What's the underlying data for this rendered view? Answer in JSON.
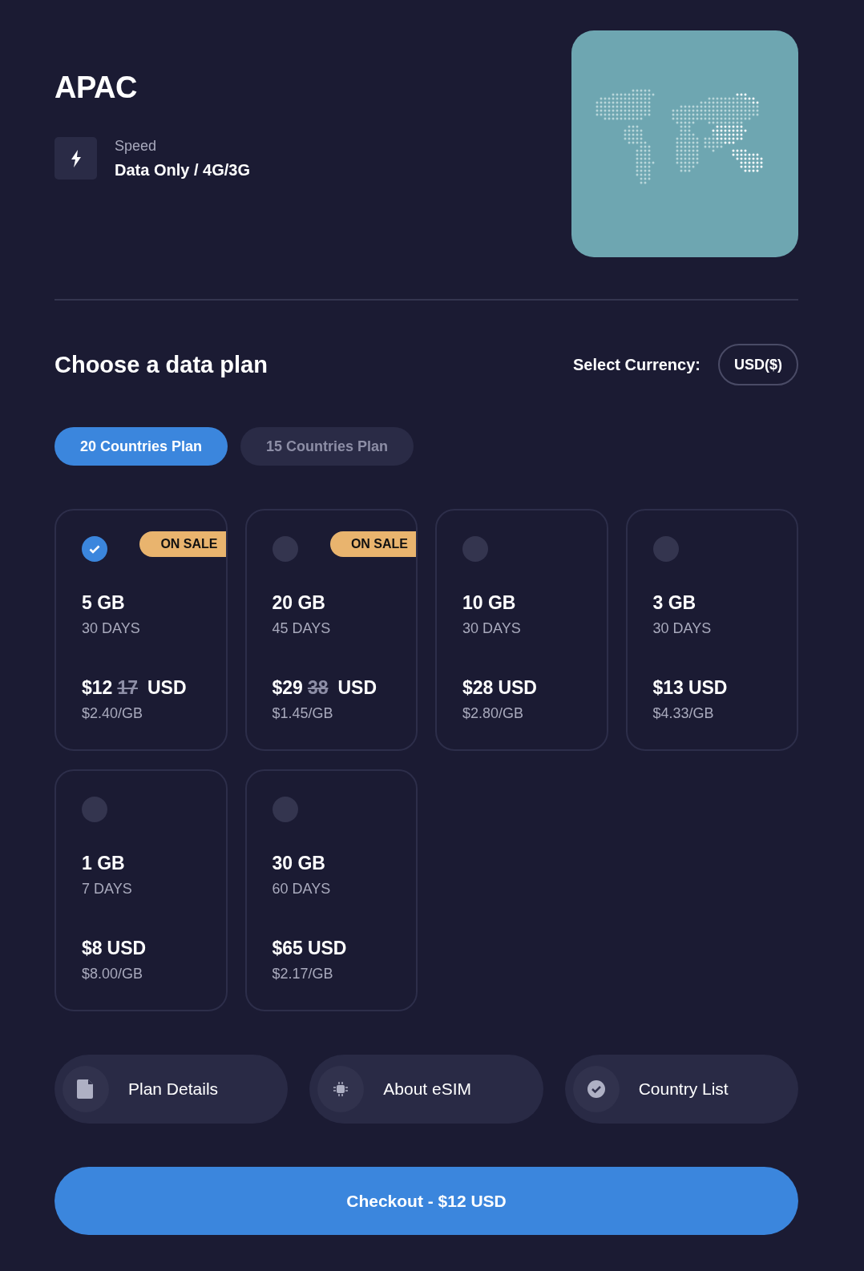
{
  "region": {
    "title": "APAC",
    "spec_label": "Speed",
    "spec_value": "Data Only / 4G/3G"
  },
  "plan_section": {
    "heading": "Choose a data plan",
    "currency_label": "Select Currency:",
    "currency": "USD($)"
  },
  "tabs": [
    {
      "label": "20 Countries Plan",
      "selected": true
    },
    {
      "label": "15 Countries Plan",
      "selected": false
    }
  ],
  "plans": [
    {
      "data": "5 GB",
      "days": "30 DAYS",
      "price": "$12",
      "old_price": "17",
      "currency": "USD",
      "per_gb": "$2.40/GB",
      "badge": "ON SALE",
      "selected": true
    },
    {
      "data": "20 GB",
      "days": "45 DAYS",
      "price": "$29",
      "old_price": "38",
      "currency": "USD",
      "per_gb": "$1.45/GB",
      "badge": "ON SALE",
      "selected": false
    },
    {
      "data": "10 GB",
      "days": "30 DAYS",
      "price": "$28",
      "currency": "USD",
      "per_gb": "$2.80/GB",
      "selected": false
    },
    {
      "data": "3 GB",
      "days": "30 DAYS",
      "price": "$13",
      "currency": "USD",
      "per_gb": "$4.33/GB",
      "selected": false
    },
    {
      "data": "1 GB",
      "days": "7 DAYS",
      "price": "$8",
      "currency": "USD",
      "per_gb": "$8.00/GB",
      "selected": false
    },
    {
      "data": "30 GB",
      "days": "60 DAYS",
      "price": "$65",
      "currency": "USD",
      "per_gb": "$2.17/GB",
      "selected": false
    }
  ],
  "info_buttons": [
    {
      "kind": "document",
      "label": "Plan Details"
    },
    {
      "kind": "chip",
      "label": "About eSIM"
    },
    {
      "kind": "check",
      "label": "Country List"
    }
  ],
  "checkout": {
    "label": "Checkout - $12 USD"
  }
}
